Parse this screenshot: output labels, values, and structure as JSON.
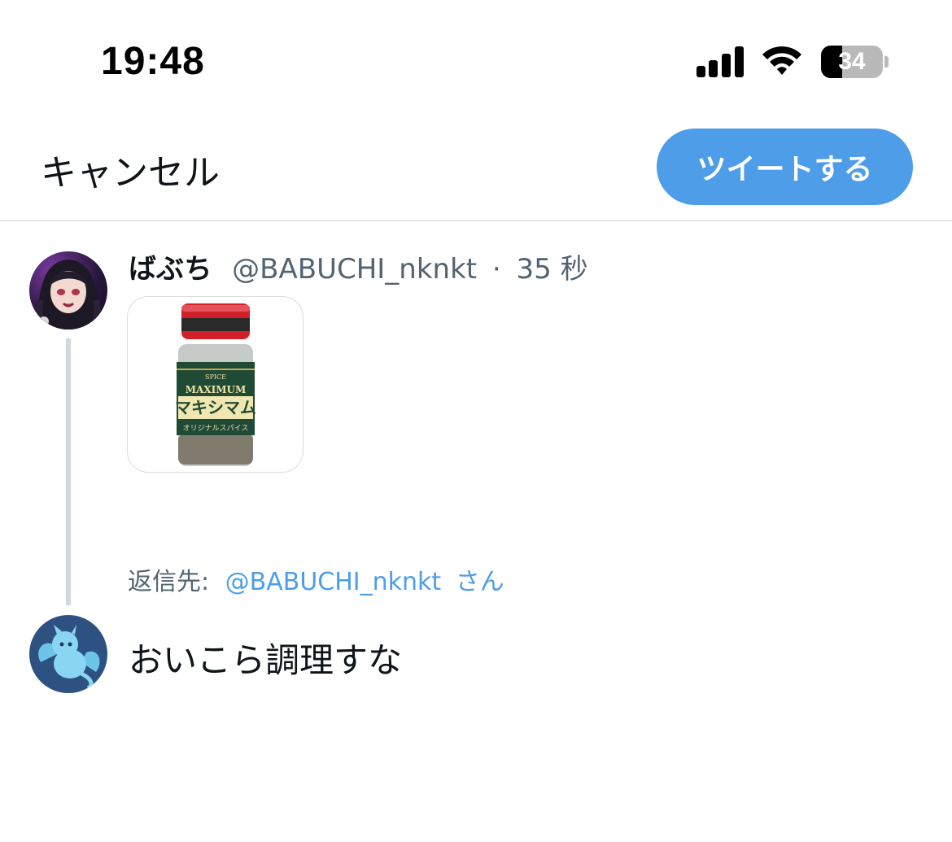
{
  "status_bar": {
    "time": "19:48",
    "battery": "34"
  },
  "header": {
    "cancel_label": "キャンセル",
    "tweet_label": "ツイートする"
  },
  "original_tweet": {
    "display_name": "ばぶち",
    "handle": "@BABUCHI_nknkt",
    "separator": "·",
    "time": "35 秒",
    "media_label": {
      "band": "SPICE",
      "brand_en": "MAXIMUM",
      "brand_jp": "マキシマム",
      "tagline": "オリジナルスパイス"
    }
  },
  "reply": {
    "prefix": "返信先:",
    "handle": "@BABUCHI_nknkt",
    "suffix": "さん",
    "text": "おいこら調理すな"
  },
  "colors": {
    "accent": "#4d9de8",
    "secondary_text": "#536471",
    "primary_text": "#0f1419"
  }
}
